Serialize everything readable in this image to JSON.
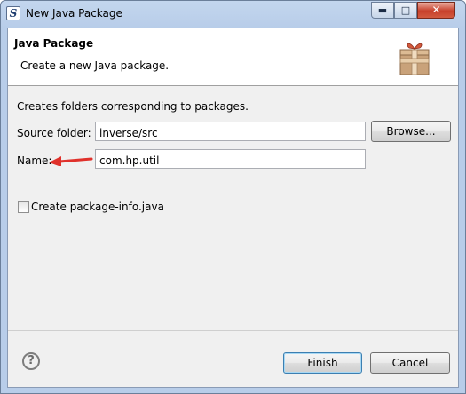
{
  "window": {
    "title": "New Java Package",
    "icon": "eclipse-s-icon",
    "controls": {
      "minimize": "minimize-icon",
      "maximize": "maximize-icon",
      "close": "close-icon"
    }
  },
  "banner": {
    "title": "Java Package",
    "description": "Create a new Java package.",
    "icon": "package-box-icon"
  },
  "form": {
    "description": "Creates folders corresponding to packages.",
    "source_folder": {
      "label": "Source folder:",
      "value": "inverse/src",
      "browse_label": "Browse..."
    },
    "name": {
      "label": "Name:",
      "value": "com.hp.util"
    },
    "create_package_info": {
      "label": "Create package-info.java",
      "checked": false
    }
  },
  "annotation": {
    "type": "red-arrow-icon",
    "color": "#e0312b"
  },
  "footer": {
    "help_icon": "help-icon",
    "finish_label": "Finish",
    "cancel_label": "Cancel"
  }
}
